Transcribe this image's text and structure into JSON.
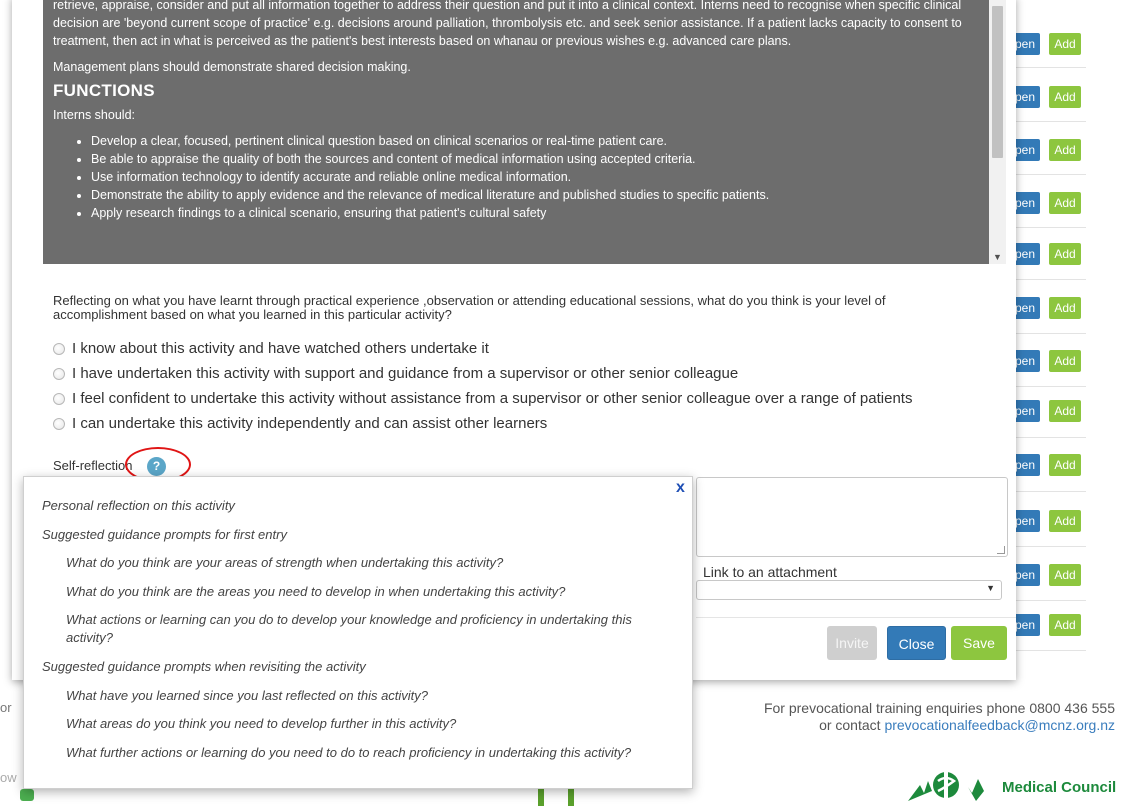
{
  "background": {
    "rows": [
      {
        "open": "pen",
        "add": "Add"
      },
      {
        "open": "pen",
        "add": "Add"
      },
      {
        "open": "pen",
        "add": "Add"
      },
      {
        "open": "pen",
        "add": "Add"
      },
      {
        "open": "pen",
        "add": "Add"
      },
      {
        "open": "pen",
        "add": "Add"
      },
      {
        "open": "pen",
        "add": "Add"
      },
      {
        "open": "pen",
        "add": "Add"
      },
      {
        "open": "pen",
        "add": "Add"
      },
      {
        "open": "pen",
        "add": "Add"
      },
      {
        "open": "pen",
        "add": "Add"
      },
      {
        "open": "pen",
        "add": "Add"
      }
    ],
    "footer": {
      "line1": "For prevocational training enquiries phone 0800 436 555",
      "line2_prefix": "or contact ",
      "email": "prevocationalfeedback@mcnz.org.nz",
      "left_a": "or",
      "left_b": "ow",
      "org_name": "Medical Council"
    },
    "colors": {
      "open_button": "#337ab7",
      "add_button": "#8dc63f"
    }
  },
  "modal": {
    "description": {
      "para1": "retrieve, appraise, consider and put all information together to address their question and put it into a clinical context. Interns need to recognise when specific clinical decision are 'beyond current scope of practice' e.g. decisions around palliation, thrombolysis etc. and seek senior assistance. If a patient lacks capacity to consent to treatment, then act in what is perceived as the patient's best interests based on whanau or previous wishes e.g. advanced care plans.",
      "para2": "Management plans should demonstrate shared decision making.",
      "heading": "FUNCTIONS",
      "intro": "Interns should:",
      "bullets": [
        "Develop a clear, focused, pertinent clinical question based on clinical scenarios or real-time patient care.",
        "Be able to appraise the quality of both the sources and content of medical information using accepted criteria.",
        "Use information technology to identify accurate and reliable online medical information.",
        "Demonstrate the ability to apply evidence and the relevance of medical literature and published studies to specific patients.",
        "Apply research findings to a clinical scenario, ensuring that patient's cultural safety"
      ]
    },
    "question": "Reflecting on what you have learnt through practical experience ,observation or attending educational sessions, what do you think is your level of accomplishment based on what you learned in this particular activity?",
    "options": [
      "I know about this activity and have watched others undertake it",
      "I have undertaken this activity with support and guidance from a supervisor or other senior colleague",
      "I feel confident to undertake this activity without assistance from a supervisor or other senior colleague over a range of patients",
      "I can undertake this activity independently and can assist other learners"
    ],
    "self_reflection_label": "Self-reflection",
    "help_icon": "question-mark-icon",
    "attachment_label": "Link to an attachment",
    "attachment_value": "",
    "buttons": {
      "invite": "Invite",
      "close": "Close",
      "save": "Save"
    }
  },
  "popover": {
    "close": "x",
    "title": "Personal reflection on this activity",
    "first_entry_heading": "Suggested guidance prompts for first entry",
    "first_entry_prompts": [
      "What do you think are your areas of strength when undertaking this activity?",
      "What do you think are the areas you need to develop in when undertaking this activity?",
      "What actions or learning can you do to develop your knowledge and proficiency in undertaking this activity?"
    ],
    "revisit_heading": "Suggested guidance prompts when revisiting the activity",
    "revisit_prompts": [
      "What have you learned since you last reflected on this activity?",
      "What areas do you think you need to develop further in this activity?",
      "What further actions or learning do you need to do to reach proficiency in undertaking this activity?"
    ]
  }
}
